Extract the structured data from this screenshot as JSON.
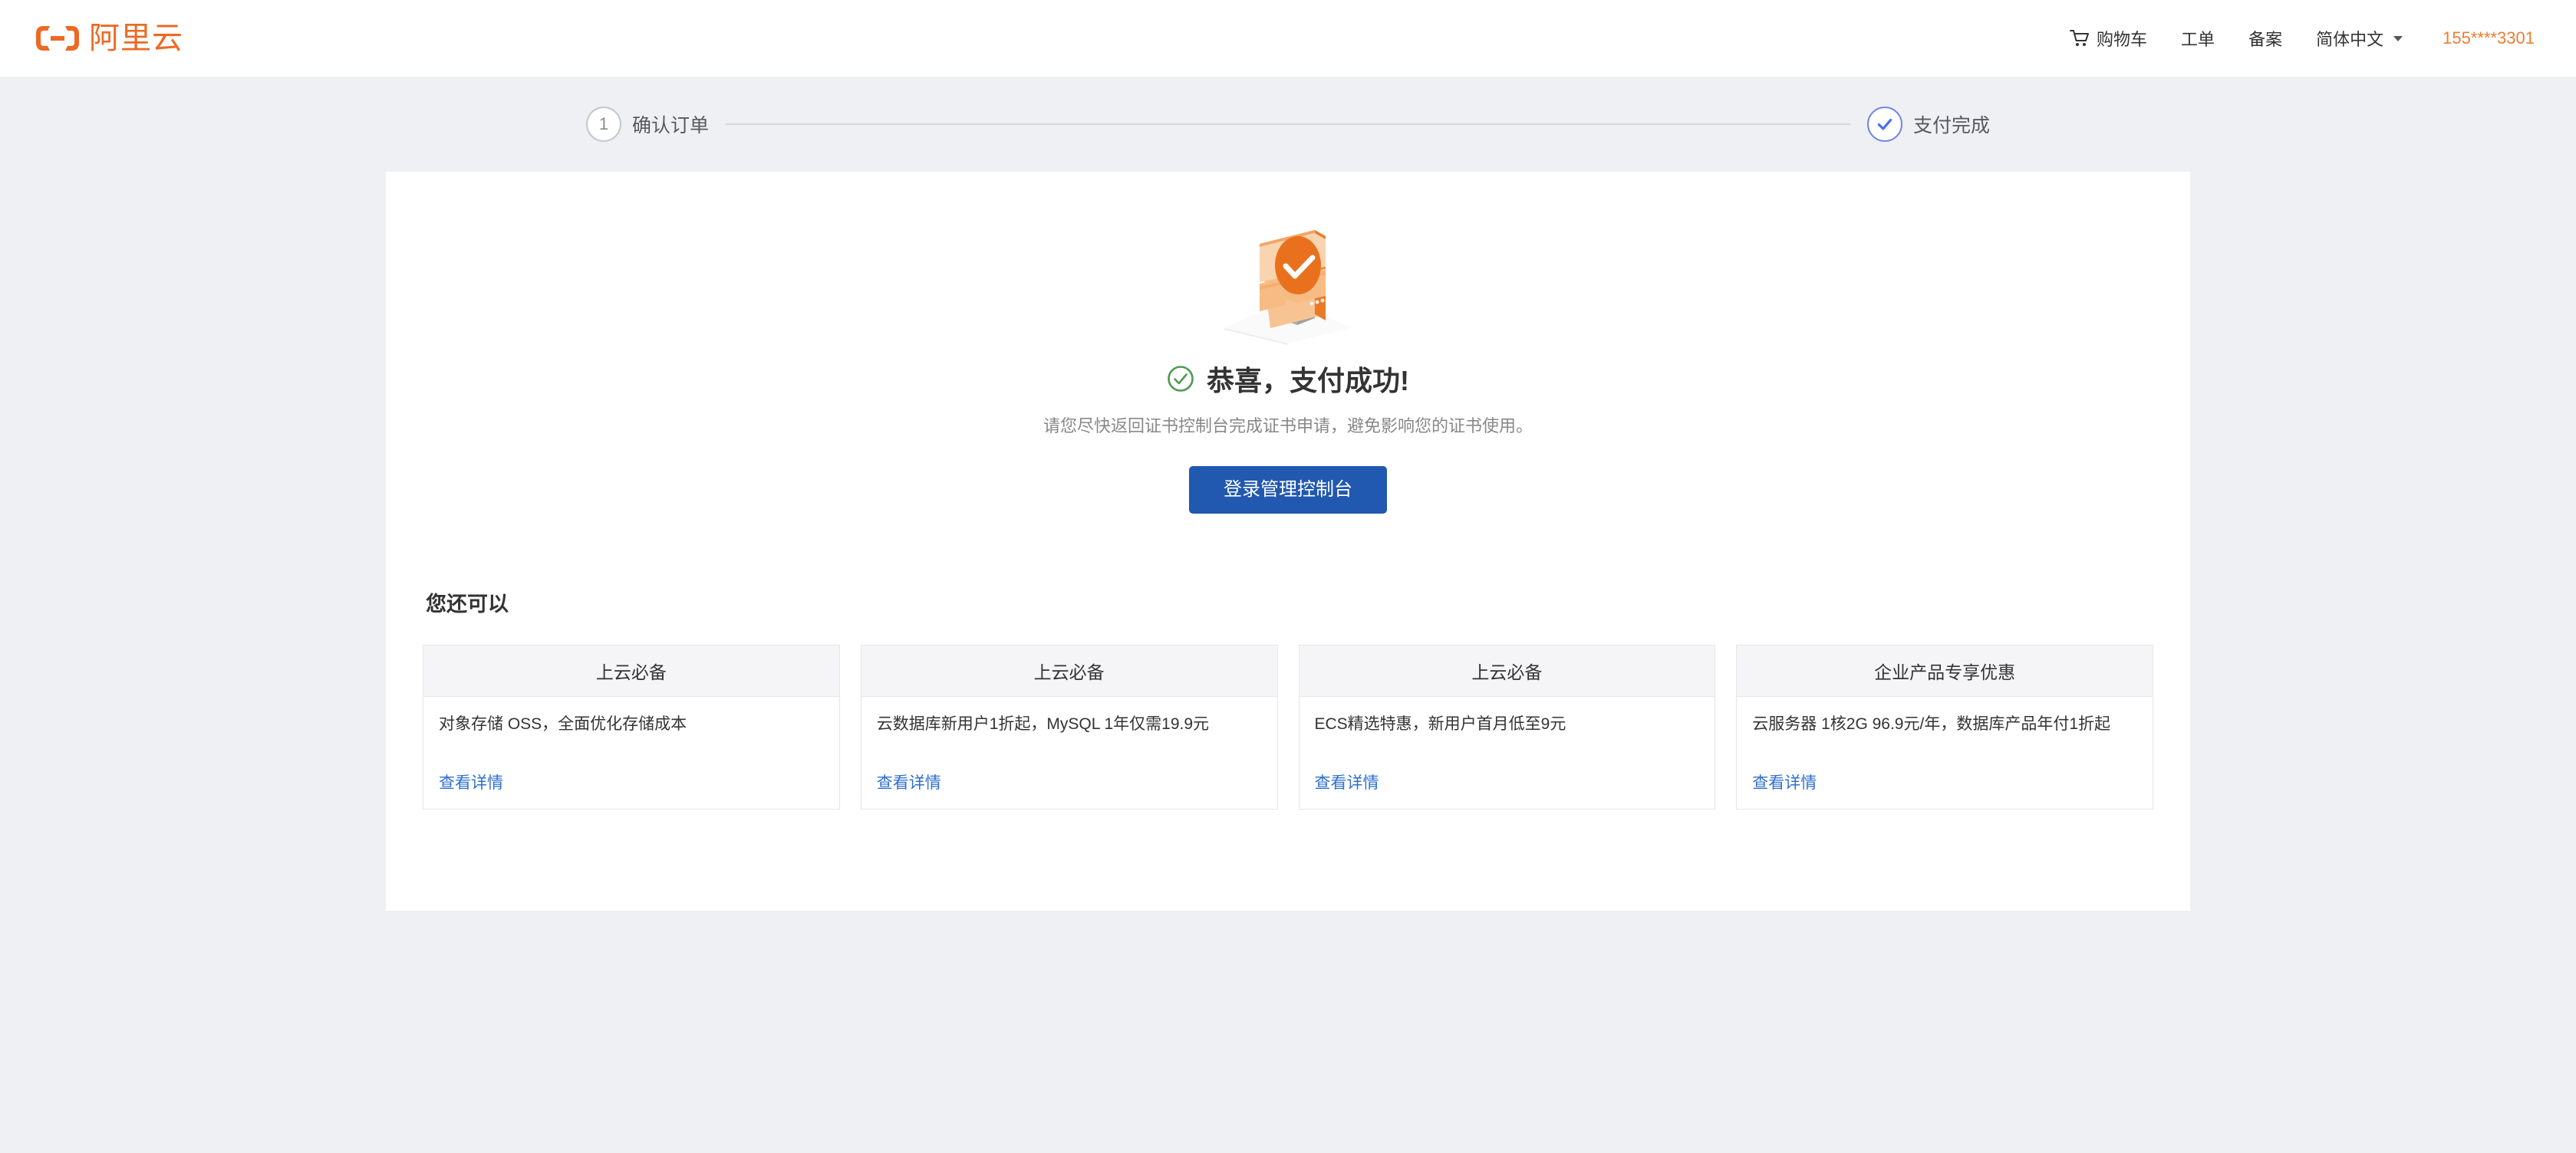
{
  "header": {
    "logo_text": "阿里云",
    "logo_icon": "alibaba-cloud-logo",
    "nav": [
      {
        "label": "购物车",
        "icon": "cart-icon"
      },
      {
        "label": "工单",
        "icon": ""
      },
      {
        "label": "备案",
        "icon": ""
      },
      {
        "label": "简体中文",
        "icon": "chevron-down-icon"
      }
    ],
    "user": "155****3301"
  },
  "steps": [
    {
      "number": "1",
      "label": "确认订单",
      "state": "pending"
    },
    {
      "number": "✓",
      "label": "支付完成",
      "state": "done"
    }
  ],
  "result": {
    "illustration": "payment-success-monitor-illustration",
    "status_icon": "circle-check-icon",
    "title": "恭喜，支付成功!",
    "subtitle": "请您尽快返回证书控制台完成证书申请，避免影响您的证书使用。",
    "button_label": "登录管理控制台"
  },
  "recommend": {
    "title": "您还可以",
    "cards": [
      {
        "head": "上云必备",
        "desc": "对象存储 OSS，全面优化存储成本",
        "link": "查看详情"
      },
      {
        "head": "上云必备",
        "desc": "云数据库新用户1折起，MySQL 1年仅需19.9元",
        "link": "查看详情"
      },
      {
        "head": "上云必备",
        "desc": "ECS精选特惠，新用户首月低至9元",
        "link": "查看详情"
      },
      {
        "head": "企业产品专享优惠",
        "desc": "云服务器 1核2G 96.9元/年，数据库产品年付1折起",
        "link": "查看详情"
      }
    ]
  },
  "colors": {
    "brand_orange": "#ec6a24",
    "primary_blue": "#2158b0",
    "link_blue": "#2f6fd0",
    "success_green": "#4f9a52",
    "page_bg": "#eff0f4"
  }
}
